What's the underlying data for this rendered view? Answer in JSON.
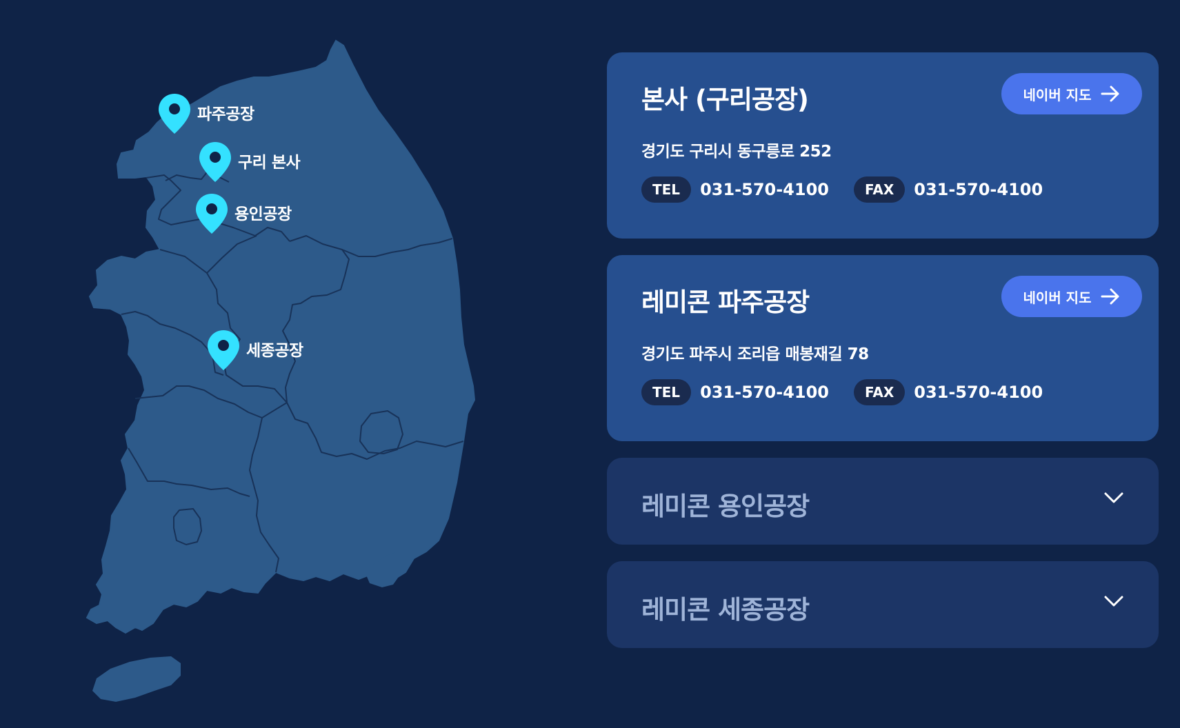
{
  "map": {
    "pins": [
      {
        "label": "파주공장"
      },
      {
        "label": "구리 본사"
      },
      {
        "label": "용인공장"
      },
      {
        "label": "세종공장"
      }
    ]
  },
  "locations": [
    {
      "title": "본사 (구리공장)",
      "button_label": "네이버 지도",
      "address": "경기도 구리시 동구릉로 252",
      "tel_label": "TEL",
      "tel": "031-570-4100",
      "fax_label": "FAX",
      "fax": "031-570-4100",
      "expanded": true
    },
    {
      "title": "레미콘 파주공장",
      "button_label": "네이버 지도",
      "address": "경기도 파주시 조리읍 매봉재길 78",
      "tel_label": "TEL",
      "tel": "031-570-4100",
      "fax_label": "FAX",
      "fax": "031-570-4100",
      "expanded": true
    },
    {
      "title": "레미콘 용인공장",
      "expanded": false
    },
    {
      "title": "레미콘 세종공장",
      "expanded": false
    }
  ],
  "colors": {
    "background": "#0f2347",
    "map_fill": "#2d5a8a",
    "pin": "#34e1ff",
    "card_open": "#264f8f",
    "card_closed": "#1c3566",
    "button": "#4a74ec"
  },
  "icons": {
    "pin": "map-pin-icon",
    "button_arrow": "arrow-right-icon",
    "collapsed": "chevron-down-icon"
  }
}
